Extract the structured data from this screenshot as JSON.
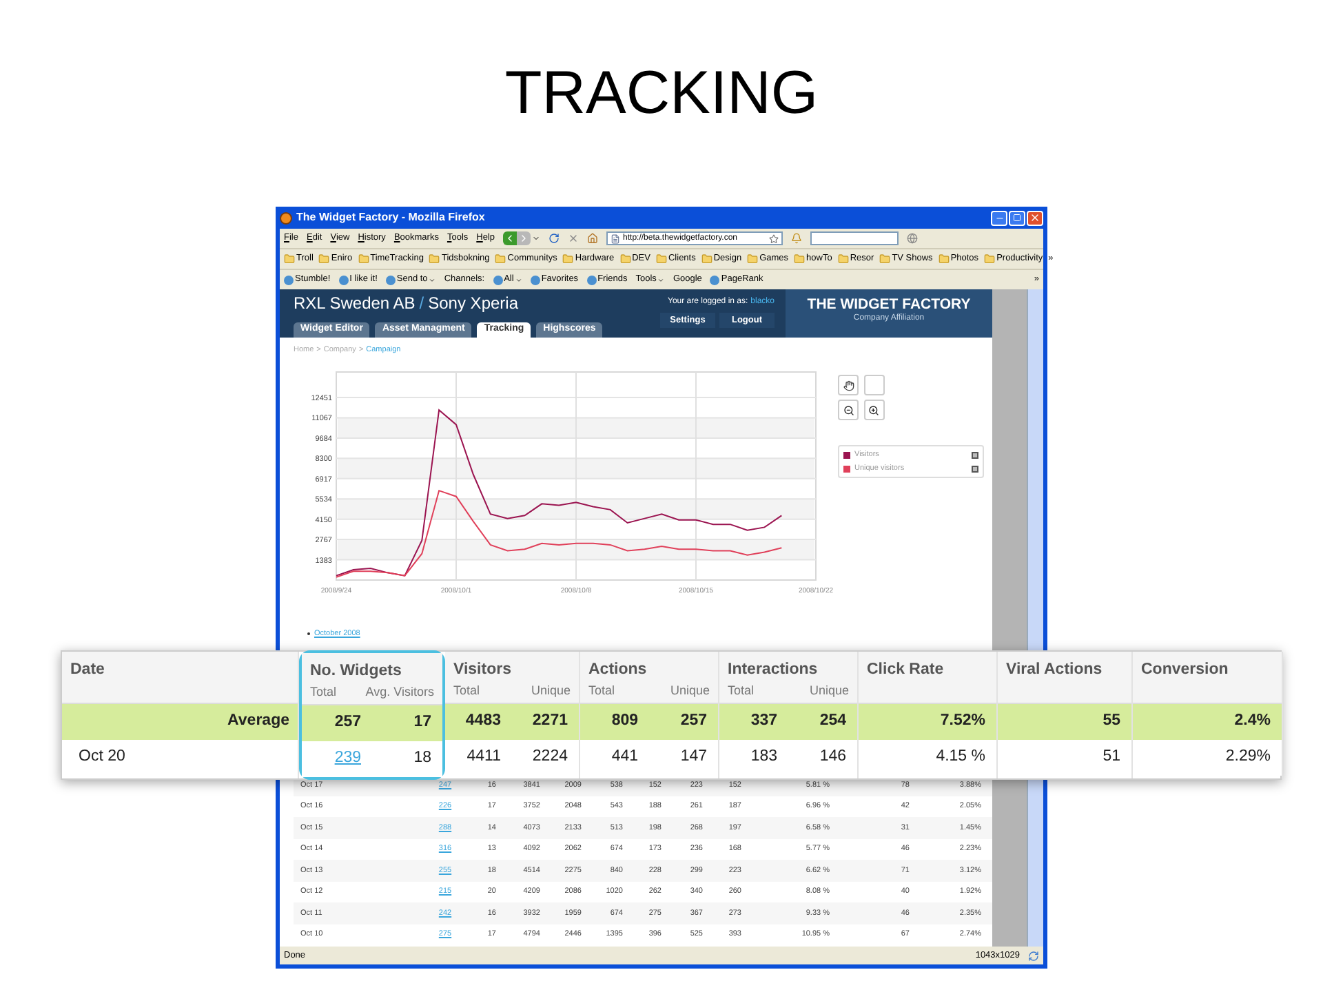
{
  "slide_title": "TRACKING",
  "window": {
    "title": "The Widget Factory - Mozilla Firefox"
  },
  "menu": [
    "File",
    "Edit",
    "View",
    "History",
    "Bookmarks",
    "Tools",
    "Help"
  ],
  "address_bar": {
    "value": "http://beta.thewidgetfactory.con"
  },
  "bookmarks": [
    "Troll",
    "Eniro",
    "TimeTracking",
    "Tidsbokning",
    "Communitys",
    "Hardware",
    "DEV",
    "Clients",
    "Design",
    "Games",
    "howTo",
    "Resor",
    "TV Shows",
    "Photos",
    "Productivity"
  ],
  "bookmarks_more": "»",
  "toolbar": [
    {
      "label": "Stumble!",
      "icon": true,
      "dropdown": false
    },
    {
      "label": "I like it!",
      "icon": true,
      "dropdown": false
    },
    {
      "label": "Send to",
      "icon": true,
      "dropdown": true
    },
    {
      "label": "Channels:",
      "icon": false,
      "dropdown": false
    },
    {
      "label": "All",
      "icon": true,
      "dropdown": true
    },
    {
      "label": "Favorites",
      "icon": true,
      "dropdown": false
    },
    {
      "label": "Friends",
      "icon": true,
      "dropdown": false
    },
    {
      "label": "Tools",
      "icon": false,
      "dropdown": true
    },
    {
      "label": "Google",
      "icon": false,
      "dropdown": false
    },
    {
      "label": "PageRank",
      "icon": true,
      "dropdown": false
    }
  ],
  "toolbar_more": "»",
  "site": {
    "client": "RXL Sweden AB",
    "separator": "/",
    "product": "Sony Xperia",
    "tabs": [
      {
        "label": "Widget Editor",
        "selected": false
      },
      {
        "label": "Asset Managment",
        "selected": false
      },
      {
        "label": "Tracking",
        "selected": true
      },
      {
        "label": "Highscores",
        "selected": false
      }
    ],
    "login_label": "Your are logged in as:",
    "user": "blacko",
    "buttons": [
      "Settings",
      "Logout"
    ],
    "brand": "THE WIDGET FACTORY",
    "brand_sub": "Company Affiliation"
  },
  "breadcrumb": [
    {
      "label": "Home",
      "selected": false
    },
    {
      "label": "Company",
      "selected": false
    },
    {
      "label": "Campaign",
      "selected": true
    }
  ],
  "breadcrumb_separator": ">",
  "chart_data": {
    "type": "line",
    "grid": true,
    "categories": [
      "2008/9/24",
      null,
      null,
      null,
      null,
      null,
      null,
      "2008/10/1",
      null,
      null,
      null,
      null,
      null,
      null,
      "2008/10/8",
      null,
      null,
      null,
      null,
      null,
      null,
      "2008/10/15",
      null,
      null,
      null,
      null,
      null,
      null,
      "2008/10/22"
    ],
    "series": [
      {
        "name": "Visitors",
        "color": "#9b1450",
        "values": [
          300,
          700,
          800,
          500,
          300,
          2700,
          11600,
          10600,
          7200,
          4500,
          4200,
          4400,
          5200,
          5100,
          5300,
          5000,
          4800,
          3900,
          4200,
          4500,
          4100,
          4100,
          3800,
          3800,
          3400,
          3600,
          4400,
          null,
          null
        ]
      },
      {
        "name": "Unique visitors",
        "color": "#e0405a",
        "values": [
          200,
          600,
          600,
          500,
          300,
          1800,
          6100,
          5700,
          4000,
          2400,
          2000,
          2100,
          2500,
          2400,
          2500,
          2500,
          2400,
          2000,
          2100,
          2300,
          2100,
          2100,
          2000,
          2000,
          1700,
          1900,
          2200,
          null,
          null
        ]
      }
    ],
    "ylim": [
      0,
      14190
    ],
    "yticks": [
      1383,
      2767,
      4150,
      5534,
      6917,
      8300,
      9684,
      11067,
      12451
    ]
  },
  "legend": [
    {
      "checked": true
    },
    {
      "checked": true
    }
  ],
  "month_link": "October 2008",
  "table_rows": [
    {
      "cells": [
        "Oct 17",
        "247",
        "16",
        "3841",
        "2009",
        "538",
        "152",
        "223",
        "152",
        "5.81 %",
        "78",
        "3.88%"
      ]
    },
    {
      "cells": [
        "Oct 16",
        "226",
        "17",
        "3752",
        "2048",
        "543",
        "188",
        "261",
        "187",
        "6.96 %",
        "42",
        "2.05%"
      ]
    },
    {
      "cells": [
        "Oct 15",
        "288",
        "14",
        "4073",
        "2133",
        "513",
        "198",
        "268",
        "197",
        "6.58 %",
        "31",
        "1.45%"
      ]
    },
    {
      "cells": [
        "Oct 14",
        "316",
        "13",
        "4092",
        "2062",
        "674",
        "173",
        "236",
        "168",
        "5.77 %",
        "46",
        "2.23%"
      ]
    },
    {
      "cells": [
        "Oct 13",
        "255",
        "18",
        "4514",
        "2275",
        "840",
        "228",
        "299",
        "223",
        "6.62 %",
        "71",
        "3.12%"
      ]
    },
    {
      "cells": [
        "Oct 12",
        "215",
        "20",
        "4209",
        "2086",
        "1020",
        "262",
        "340",
        "260",
        "8.08 %",
        "40",
        "1.92%"
      ]
    },
    {
      "cells": [
        "Oct 11",
        "242",
        "16",
        "3932",
        "1959",
        "674",
        "275",
        "367",
        "273",
        "9.33 %",
        "46",
        "2.35%"
      ]
    },
    {
      "cells": [
        "Oct 10",
        "275",
        "17",
        "4794",
        "2446",
        "1395",
        "396",
        "525",
        "393",
        "10.95 %",
        "67",
        "2.74%"
      ]
    }
  ],
  "zoom_table": {
    "groups": [
      {
        "label": "Date",
        "highlighted": false
      },
      {
        "label": "No. Widgets",
        "sub": [
          "Total",
          "Avg. Visitors"
        ],
        "highlighted": true
      },
      {
        "label": "Visitors",
        "sub": [
          "Total",
          "Unique"
        ],
        "highlighted": false
      },
      {
        "label": "Actions",
        "sub": [
          "Total",
          "Unique"
        ],
        "highlighted": false
      },
      {
        "label": "Interactions",
        "sub": [
          "Total",
          "Unique"
        ],
        "highlighted": false
      },
      {
        "label": "Click Rate",
        "highlighted": false
      },
      {
        "label": "Viral Actions",
        "highlighted": false
      },
      {
        "label": "Conversion",
        "highlighted": false
      }
    ],
    "rows": [
      {
        "kind": "average",
        "cells": [
          "Average",
          "257",
          "17",
          "4483",
          "2271",
          "809",
          "257",
          "337",
          "254",
          "7.52%",
          "55",
          "2.4%"
        ]
      },
      {
        "kind": "day",
        "cells": [
          "Oct 20",
          "239",
          "18",
          "4411",
          "2224",
          "441",
          "147",
          "183",
          "146",
          "4.15 %",
          "51",
          "2.29%"
        ]
      }
    ]
  },
  "status_bar": {
    "text": "Done",
    "size": "1043x1029"
  }
}
